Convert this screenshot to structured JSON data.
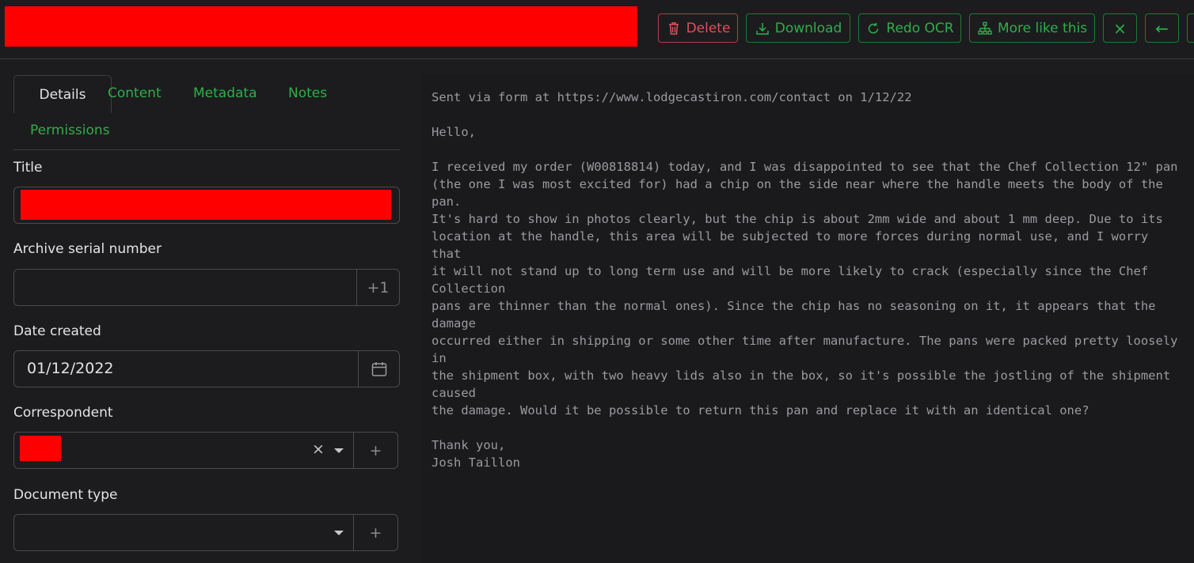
{
  "toolbar": {
    "delete_label": "Delete",
    "download_label": "Download",
    "redo_ocr_label": "Redo OCR",
    "more_like_this_label": "More like this",
    "close_symbol": "×",
    "back_symbol": "←"
  },
  "tabs": {
    "details": "Details",
    "content": "Content",
    "metadata": "Metadata",
    "notes": "Notes",
    "permissions": "Permissions"
  },
  "fields": {
    "title_label": "Title",
    "asn_label": "Archive serial number",
    "asn_value": "",
    "asn_increment": "+1",
    "date_label": "Date created",
    "date_value": "01/12/2022",
    "correspondent_label": "Correspondent",
    "clear_symbol": "×",
    "add_symbol": "+",
    "document_type_label": "Document type"
  },
  "document": {
    "text": "Sent via form at https://www.lodgecastiron.com/contact on 1/12/22\n\nHello,\n\nI received my order (W00818814) today, and I was disappointed to see that the Chef Collection 12\" pan\n(the one I was most excited for) had a chip on the side near where the handle meets the body of the\npan.\nIt's hard to show in photos clearly, but the chip is about 2mm wide and about 1 mm deep. Due to its\nlocation at the handle, this area will be subjected to more forces during normal use, and I worry\nthat\nit will not stand up to long term use and will be more likely to crack (especially since the Chef\nCollection\npans are thinner than the normal ones). Since the chip has no seasoning on it, it appears that the\ndamage\noccurred either in shipping or some other time after manufacture. The pans were packed pretty loosely\nin\nthe shipment box, with two heavy lids also in the box, so it's possible the jostling of the shipment\ncaused\nthe damage. Would it be possible to return this pan and replace it with an identical one?\n\nThank you,\nJosh Taillon"
  }
}
